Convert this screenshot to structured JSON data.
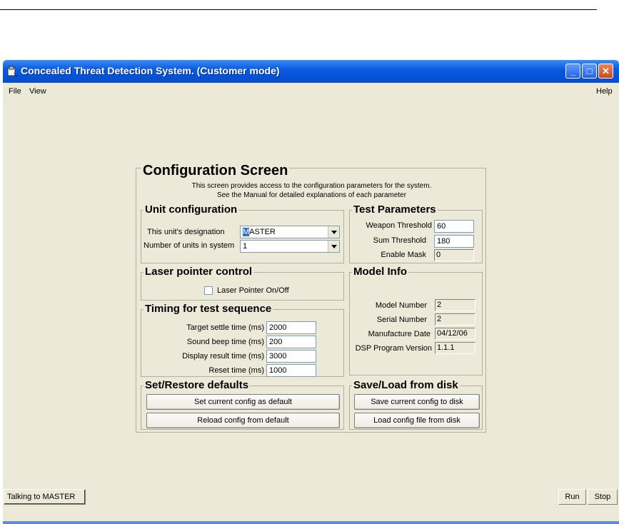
{
  "window": {
    "title": "Concealed Threat Detection System.  (Customer mode)",
    "minimize": "_",
    "maximize": "□",
    "close": "✕"
  },
  "menu": {
    "file": "File",
    "view": "View",
    "help": "Help"
  },
  "config": {
    "title": "Configuration Screen",
    "desc_line1": "This screen provides access to the configuration parameters for the system.",
    "desc_line2": "See the Manual for detailed explanations of each parameter"
  },
  "unit_config": {
    "title": "Unit configuration",
    "designation_label": "This unit's designation",
    "designation_value_first": "M",
    "designation_value_rest": "ASTER",
    "units_label": "Number of units in system",
    "units_value": "1"
  },
  "test_params": {
    "title": "Test Parameters",
    "weapon_label": "Weapon Threshold",
    "weapon_value": "60",
    "sum_label": "Sum Threshold",
    "sum_value": "180",
    "mask_label": "Enable Mask",
    "mask_value": "0"
  },
  "laser": {
    "title": "Laser pointer control",
    "checkbox_label": "Laser Pointer On/Off"
  },
  "model_info": {
    "title": "Model Info",
    "model_label": "Model Number",
    "model_value": "2",
    "serial_label": "Serial Number",
    "serial_value": "2",
    "date_label": "Manufacture Date",
    "date_value": "04/12/06",
    "dsp_label": "DSP Program Version",
    "dsp_value": "1.1.1"
  },
  "timing": {
    "title": "Timing for test sequence",
    "settle_label": "Target settle time (ms)",
    "settle_value": "2000",
    "beep_label": "Sound beep time (ms)",
    "beep_value": "200",
    "display_label": "Display result time (ms)",
    "display_value": "3000",
    "reset_label": "Reset time (ms)",
    "reset_value": "1000"
  },
  "defaults": {
    "title": "Set/Restore defaults",
    "set_button": "Set current config as default",
    "reload_button": "Reload config from default"
  },
  "disk": {
    "title": "Save/Load from disk",
    "save_button": "Save current config to disk",
    "load_button": "Load config file from disk"
  },
  "status": {
    "connection": "Talking to MASTER",
    "run": "Run",
    "stop": "Stop"
  }
}
